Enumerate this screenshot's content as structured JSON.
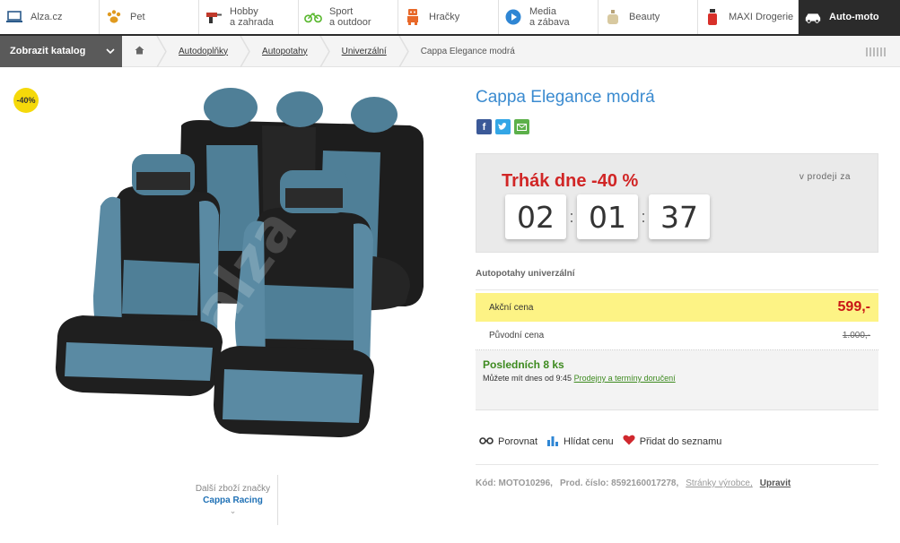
{
  "topnav": {
    "items": [
      {
        "label": "Alza.cz",
        "icon": "laptop-icon"
      },
      {
        "label": "Pet",
        "icon": "paw-icon"
      },
      {
        "label": "Hobby\na zahrada",
        "icon": "drill-icon"
      },
      {
        "label": "Sport\na outdoor",
        "icon": "bicycle-icon"
      },
      {
        "label": "Hračky",
        "icon": "robot-icon"
      },
      {
        "label": "Media\na zábava",
        "icon": "play-icon"
      },
      {
        "label": "Beauty",
        "icon": "perfume-icon"
      },
      {
        "label": "MAXI Drogerie",
        "icon": "spray-icon"
      },
      {
        "label": "Auto-moto",
        "icon": "car-icon"
      }
    ]
  },
  "breadcrumb": {
    "catalog_label": "Zobrazit katalog",
    "items": [
      "Autodoplňky",
      "Autopotahy",
      "Univerzální"
    ],
    "current": "Cappa Elegance modrá"
  },
  "product": {
    "badge": "-40%",
    "title": "Cappa Elegance modrá",
    "watermark": "alza",
    "brand_more_label": "Další zboží značky",
    "brand_name": "Cappa Racing"
  },
  "deal": {
    "headline": "Trhák dne -40 %",
    "sale_label": "v prodeji za",
    "hours": "02",
    "minutes": "01",
    "seconds": "37"
  },
  "pricing": {
    "category": "Autopotahy univerzální",
    "action_label": "Akční cena",
    "action_price": "599,-",
    "original_label": "Původní cena",
    "original_price": "1.000,-"
  },
  "stock": {
    "status": "Posledních 8 ks",
    "pickup_text": "Můžete mít dnes od 9:45",
    "pickup_link": "Prodejny a termíny doručení"
  },
  "actions": {
    "compare": "Porovnat",
    "watch": "Hlídat cenu",
    "wishlist": "Přidat do seznamu"
  },
  "codes": {
    "code": "Kód: MOTO10296,",
    "prod_number": "Prod. číslo: 8592160017278,",
    "manufacturer_link": "Stránky výrobce,",
    "edit_link": "Upravit"
  },
  "colors": {
    "title_blue": "#3b8bd0",
    "deal_red": "#d12626",
    "price_highlight": "#fdf385",
    "stock_green": "#3d8a1f",
    "nav_dark": "#2b2b2b"
  }
}
